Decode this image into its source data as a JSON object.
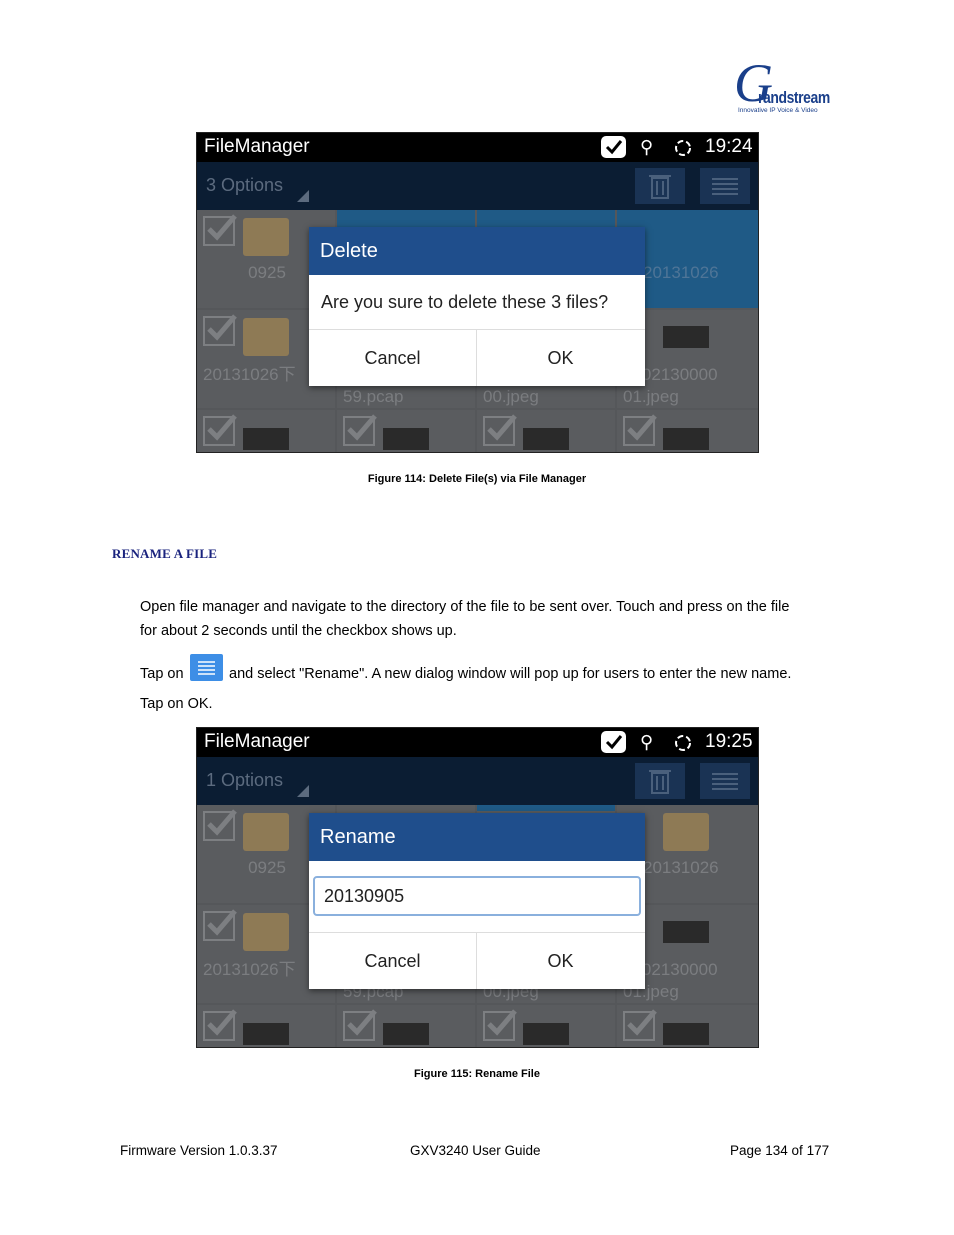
{
  "logo": {
    "letter": "G",
    "word": "randstream",
    "tagline": "Innovative IP Voice & Video"
  },
  "figure1": {
    "status": {
      "title": "FileManager",
      "time": "19:24"
    },
    "options_label": "3 Options",
    "cells": [
      "0925",
      "",
      "",
      "20131026",
      "20131026下",
      "59.pcap",
      "00.jpeg",
      "1402130000",
      "01.jpeg"
    ],
    "dialog": {
      "title": "Delete",
      "message": "Are you sure to delete these  3 files?",
      "cancel": "Cancel",
      "ok": "OK"
    },
    "caption": "Figure 114: Delete File(s) via File Manager"
  },
  "section_heading": "RENAME A FILE",
  "paragraph1_line1": "Open file manager and navigate to the directory of the file to be sent over. Touch and press on the file",
  "paragraph1_line2": "for about 2 seconds until the checkbox shows up.",
  "paragraph2_prefix": "Tap on",
  "paragraph2_suffix": "and select \"Rename\". A new dialog window will pop up for users to enter the new name.",
  "paragraph2_line2": "Tap on OK.",
  "figure2": {
    "status": {
      "title": "FileManager",
      "time": "19:25"
    },
    "options_label": "1 Options",
    "cells": [
      "0925",
      "20131026",
      "20131026下",
      "59.pcap",
      "00.jpeg",
      "1402130000",
      "01.jpeg"
    ],
    "dialog": {
      "title": "Rename",
      "input_value": "20130905",
      "cancel": "Cancel",
      "ok": "OK"
    },
    "caption": "Figure 115: Rename File"
  },
  "footer": {
    "left": "Firmware Version 1.0.3.37",
    "center": "GXV3240 User Guide",
    "right": "Page 134 of 177"
  },
  "colors": {
    "brand_blue": "#1a3f8a",
    "dialog_header": "#1f4e8c",
    "section_heading": "#1a237e"
  }
}
